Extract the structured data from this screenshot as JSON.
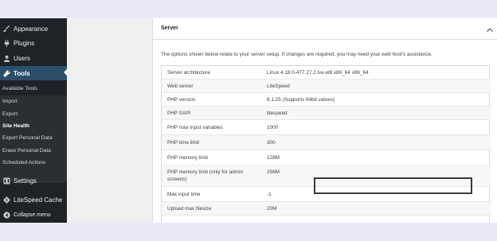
{
  "sidebar": {
    "menu": [
      {
        "label": "Appearance",
        "icon": "paintbrush-icon"
      },
      {
        "label": "Plugins",
        "icon": "plugin-icon"
      },
      {
        "label": "Users",
        "icon": "users-icon"
      },
      {
        "label": "Tools",
        "icon": "wrench-icon",
        "active": true
      }
    ],
    "submenu": [
      "Available Tools",
      "Import",
      "Export",
      "Site Health",
      "Export Personal Data",
      "Erase Personal Data",
      "Scheduled Actions"
    ],
    "current_submenu": "Site Health",
    "bottom": [
      {
        "label": "Settings",
        "icon": "settings-icon"
      },
      {
        "label": "LiteSpeed Cache",
        "icon": "litespeed-icon"
      },
      {
        "label": "Collapse menu",
        "icon": "collapse-icon"
      }
    ]
  },
  "panel": {
    "title": "Server",
    "description": "The options shown below relate to your server setup. If changes are required, you may need your web host's assistance.",
    "rows": [
      {
        "label": "Server architecture",
        "value": "Linux 4.18.0-477.27.2.lve.el8.x86_64 x86_64"
      },
      {
        "label": "Web server",
        "value": "LiteSpeed"
      },
      {
        "label": "PHP version",
        "value": "8.1.25 (Supports 64bit values)"
      },
      {
        "label": "PHP SAPI",
        "value": "litespeed"
      },
      {
        "label": "PHP max input variables",
        "value": "1000"
      },
      {
        "label": "PHP time limit",
        "value": "300"
      },
      {
        "label": "PHP memory limit",
        "value": "128M"
      },
      {
        "label": "PHP memory limit (only for admin screens)",
        "value": "256M"
      },
      {
        "label": "Max input time",
        "value": "-1"
      },
      {
        "label": "Upload max filesize",
        "value": "20M"
      }
    ],
    "highlighted_row": "PHP memory limit"
  },
  "colors": {
    "sidebar_bg": "#1f2226",
    "active_menu_bg": "#2a4f6d",
    "page_bg": "#ece9f7",
    "highlight_border": "#3a3a3a"
  }
}
